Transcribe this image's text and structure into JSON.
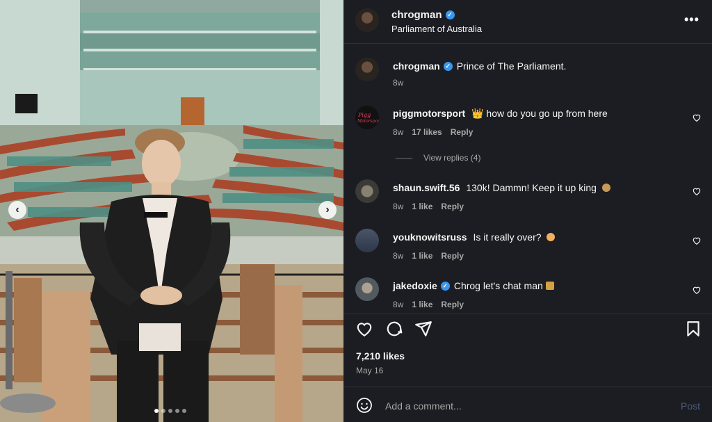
{
  "post": {
    "username": "chrogman",
    "location": "Parliament of Australia",
    "caption": "Prince of The Parliament.",
    "caption_age": "8w",
    "likes": "7,210 likes",
    "date": "May 16",
    "carousel": {
      "slide_count": 5,
      "current": 1
    }
  },
  "header": {
    "more_label": "•••"
  },
  "replies": {
    "view_label": "View replies (4)"
  },
  "comments": [
    {
      "user": "piggmotorsport",
      "text": "👑 how do you go up from here",
      "age": "8w",
      "likes": "17 likes",
      "reply": "Reply"
    },
    {
      "user": "shaun.swift.56",
      "text": "130k! Dammn! Keep it up king",
      "age": "8w",
      "likes": "1 like",
      "reply": "Reply"
    },
    {
      "user": "youknowitsruss",
      "text": "Is it really over?",
      "age": "8w",
      "likes": "1 like",
      "reply": "Reply"
    },
    {
      "user": "jakedoxie",
      "text": "Chrog let's chat man",
      "age": "8w",
      "likes": "1 like",
      "reply": "Reply"
    }
  ],
  "composer": {
    "placeholder": "Add a comment...",
    "post_label": "Post"
  },
  "icons": [
    "more-icon",
    "verified-icon",
    "heart-icon",
    "comment-icon",
    "share-icon",
    "bookmark-icon",
    "emoji-icon",
    "chevron-left-icon",
    "chevron-right-icon"
  ],
  "colors": {
    "panel_bg": "#1c1d22",
    "verified": "#3897f0",
    "muted": "#a8a8a8",
    "post_disabled": "#4a5a7a"
  }
}
